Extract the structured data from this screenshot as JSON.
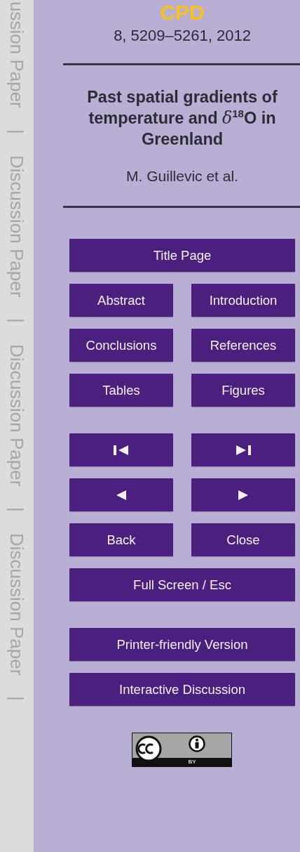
{
  "margin_labels": [
    "ussion Paper",
    "|",
    "Discussion Paper",
    "|",
    "Discussion Paper",
    "|",
    "Discussion Paper",
    "|"
  ],
  "journal": "CPD",
  "citation": "8, 5209–5261, 2012",
  "title": "Past spatial gradients of temperature and *δ*$^{18}$O in Greenland",
  "authors": "M. Guillevic et al.",
  "button_groups": [
    [
      [
        {
          "kind": "text",
          "label": "Title Page"
        }
      ],
      [
        {
          "kind": "text",
          "label": "Abstract"
        },
        {
          "kind": "text",
          "label": "Introduction"
        }
      ],
      [
        {
          "kind": "text",
          "label": "Conclusions"
        },
        {
          "kind": "text",
          "label": "References"
        }
      ],
      [
        {
          "kind": "text",
          "label": "Tables"
        },
        {
          "kind": "text",
          "label": "Figures"
        }
      ]
    ],
    [
      [
        {
          "kind": "first"
        },
        {
          "kind": "last"
        }
      ],
      [
        {
          "kind": "prev"
        },
        {
          "kind": "next"
        }
      ],
      [
        {
          "kind": "text",
          "label": "Back"
        },
        {
          "kind": "text",
          "label": "Close"
        }
      ],
      [
        {
          "kind": "text",
          "label": "Full Screen / Esc"
        }
      ]
    ],
    [
      [
        {
          "kind": "text",
          "label": "Printer-friendly Version"
        }
      ],
      [
        {
          "kind": "text",
          "label": "Interactive Discussion"
        }
      ]
    ]
  ],
  "license_badge": {
    "label": "BY"
  }
}
